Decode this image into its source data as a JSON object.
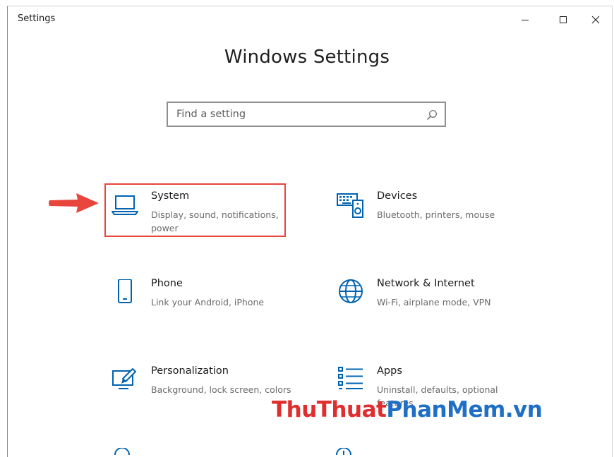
{
  "window": {
    "title": "Settings"
  },
  "page": {
    "title": "Windows Settings"
  },
  "search": {
    "placeholder": "Find a setting"
  },
  "tiles": [
    {
      "title": "System",
      "description": "Display, sound, notifications, power",
      "icon": "laptop-icon"
    },
    {
      "title": "Devices",
      "description": "Bluetooth, printers, mouse",
      "icon": "keyboard-speaker-icon"
    },
    {
      "title": "Phone",
      "description": "Link your Android, iPhone",
      "icon": "phone-icon"
    },
    {
      "title": "Network & Internet",
      "description": "Wi-Fi, airplane mode, VPN",
      "icon": "globe-icon"
    },
    {
      "title": "Personalization",
      "description": "Background, lock screen, colors",
      "icon": "paintbrush-icon"
    },
    {
      "title": "Apps",
      "description": "Uninstall, defaults, optional features",
      "icon": "apps-list-icon"
    }
  ],
  "watermark": {
    "part1": "ThuThuat",
    "part2": "PhanMem",
    "part3": ".vn"
  },
  "colors": {
    "icon_blue": "#0063b1",
    "highlight_red": "#e8453c"
  }
}
